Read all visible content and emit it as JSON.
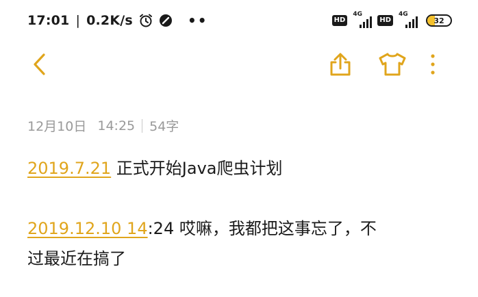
{
  "status_bar": {
    "time": "17:01",
    "separator": "|",
    "net_speed": "0.2K/s",
    "dots": "••",
    "hd1": "HD",
    "net1": "4G",
    "hd2": "HD",
    "net2": "4G",
    "battery_level": "32",
    "icons": [
      "alarm-clock-icon",
      "do-not-disturb-icon",
      "signal-bars-icon",
      "battery-icon"
    ]
  },
  "toolbar": {
    "back_icon": "chevron-left-icon",
    "share_icon": "share-icon",
    "theme_icon": "tshirt-icon",
    "more_icon": "more-vertical-icon",
    "accent_color": "#e0a51c"
  },
  "note": {
    "date": "12月10日",
    "time": "14:25",
    "word_count": "54字",
    "entries": [
      {
        "date_link": "2019.7.21",
        "text": " 正式开始Java爬虫计划"
      },
      {
        "date_link": "2019.12.10 14",
        "text_line1": ":24 哎嘛，我都把这事忘了，不",
        "text_line2": "过最近在搞了"
      }
    ]
  }
}
